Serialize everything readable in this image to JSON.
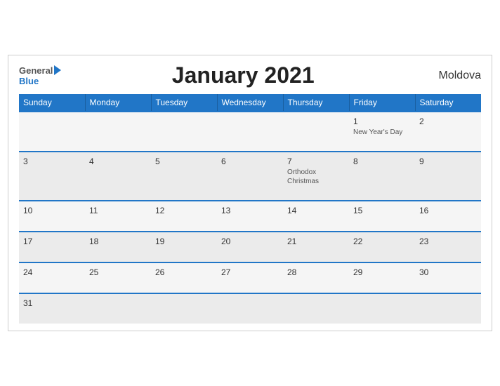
{
  "header": {
    "title": "January 2021",
    "country": "Moldova",
    "logo_general": "General",
    "logo_blue": "Blue"
  },
  "days_of_week": [
    "Sunday",
    "Monday",
    "Tuesday",
    "Wednesday",
    "Thursday",
    "Friday",
    "Saturday"
  ],
  "weeks": [
    {
      "days": [
        {
          "num": "",
          "holiday": ""
        },
        {
          "num": "",
          "holiday": ""
        },
        {
          "num": "",
          "holiday": ""
        },
        {
          "num": "",
          "holiday": ""
        },
        {
          "num": "",
          "holiday": ""
        },
        {
          "num": "1",
          "holiday": "New Year's Day"
        },
        {
          "num": "2",
          "holiday": ""
        }
      ]
    },
    {
      "days": [
        {
          "num": "3",
          "holiday": ""
        },
        {
          "num": "4",
          "holiday": ""
        },
        {
          "num": "5",
          "holiday": ""
        },
        {
          "num": "6",
          "holiday": ""
        },
        {
          "num": "7",
          "holiday": "Orthodox Christmas"
        },
        {
          "num": "8",
          "holiday": ""
        },
        {
          "num": "9",
          "holiday": ""
        }
      ]
    },
    {
      "days": [
        {
          "num": "10",
          "holiday": ""
        },
        {
          "num": "11",
          "holiday": ""
        },
        {
          "num": "12",
          "holiday": ""
        },
        {
          "num": "13",
          "holiday": ""
        },
        {
          "num": "14",
          "holiday": ""
        },
        {
          "num": "15",
          "holiday": ""
        },
        {
          "num": "16",
          "holiday": ""
        }
      ]
    },
    {
      "days": [
        {
          "num": "17",
          "holiday": ""
        },
        {
          "num": "18",
          "holiday": ""
        },
        {
          "num": "19",
          "holiday": ""
        },
        {
          "num": "20",
          "holiday": ""
        },
        {
          "num": "21",
          "holiday": ""
        },
        {
          "num": "22",
          "holiday": ""
        },
        {
          "num": "23",
          "holiday": ""
        }
      ]
    },
    {
      "days": [
        {
          "num": "24",
          "holiday": ""
        },
        {
          "num": "25",
          "holiday": ""
        },
        {
          "num": "26",
          "holiday": ""
        },
        {
          "num": "27",
          "holiday": ""
        },
        {
          "num": "28",
          "holiday": ""
        },
        {
          "num": "29",
          "holiday": ""
        },
        {
          "num": "30",
          "holiday": ""
        }
      ]
    },
    {
      "days": [
        {
          "num": "31",
          "holiday": ""
        },
        {
          "num": "",
          "holiday": ""
        },
        {
          "num": "",
          "holiday": ""
        },
        {
          "num": "",
          "holiday": ""
        },
        {
          "num": "",
          "holiday": ""
        },
        {
          "num": "",
          "holiday": ""
        },
        {
          "num": "",
          "holiday": ""
        }
      ]
    }
  ]
}
